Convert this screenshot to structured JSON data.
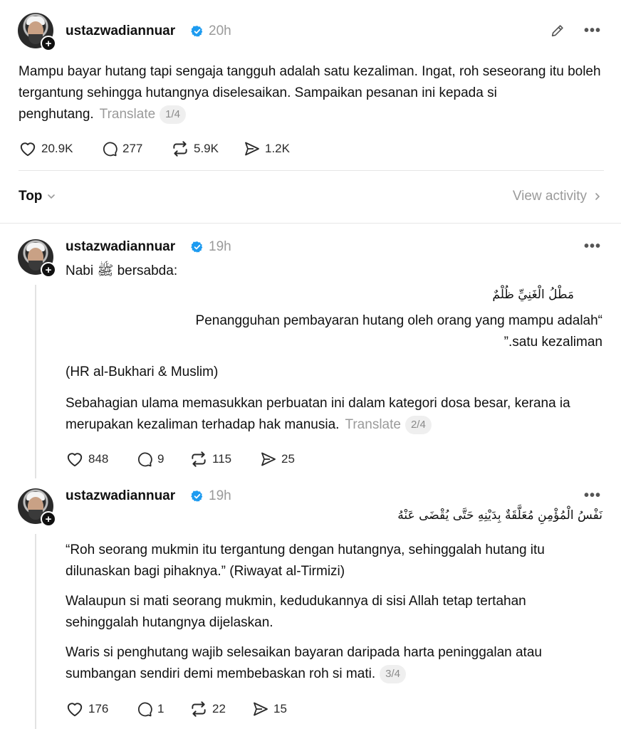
{
  "main_post": {
    "username": "ustazwadiannuar",
    "time": "20h",
    "text": "Mampu bayar hutang tapi sengaja tangguh adalah satu kezaliman. Ingat, roh seseorang itu boleh tergantung sehingga hutangnya diselesaikan. Sampaikan pesanan ini kepada si penghutang.",
    "translate": "Translate",
    "page": "1/4",
    "likes": "20.9K",
    "replies": "277",
    "reposts": "5.9K",
    "shares": "1.2K"
  },
  "sort": {
    "label": "Top",
    "view_activity": "View activity"
  },
  "reply1": {
    "username": "ustazwadiannuar",
    "time": "19h",
    "intro": "Nabi ﷺ bersabda:",
    "arabic": "مَطْلُ الْغَنِيِّ ظُلْمٌ",
    "quote_line1": "Penangguhan pembayaran hutang oleh orang yang mampu adalah“",
    "quote_line2": "”.satu kezaliman",
    "source": "(HR al-Bukhari & Muslim)",
    "text": "Sebahagian ulama memasukkan perbuatan ini dalam kategori dosa besar, kerana ia merupakan kezaliman terhadap hak manusia.",
    "translate": "Translate",
    "page": "2/4",
    "likes": "848",
    "replies": "9",
    "reposts": "115",
    "shares": "25"
  },
  "reply2": {
    "username": "ustazwadiannuar",
    "time": "19h",
    "arabic": "نَفْسُ الْمُؤْمِنِ مُعَلَّقَةٌ بِدَيْنِهِ حَتَّى يُقْضَى عَنْهُ",
    "quote": "“Roh seorang mukmin itu tergantung dengan hutangnya, sehinggalah hutang itu dilunaskan bagi pihaknya.” (Riwayat al-Tirmizi)",
    "para2": "Walaupun si mati seorang mukmin, kedudukannya di sisi Allah tetap tertahan sehinggalah hutangnya dijelaskan.",
    "para3": "Waris si penghutang wajib selesaikan bayaran daripada harta peninggalan atau sumbangan sendiri demi membebaskan roh si mati.",
    "page": "3/4",
    "likes": "176",
    "replies": "1",
    "reposts": "22",
    "shares": "15"
  },
  "icons": [
    "verified-badge-icon",
    "edit-pencil-icon",
    "more-dots-icon",
    "heart-icon",
    "comment-icon",
    "repost-icon",
    "share-icon",
    "chevron-down-icon",
    "chevron-right-icon",
    "follow-plus-icon"
  ],
  "colors": {
    "verified": "#1d9bf0",
    "muted": "#9a9a9a",
    "text": "#101010"
  }
}
